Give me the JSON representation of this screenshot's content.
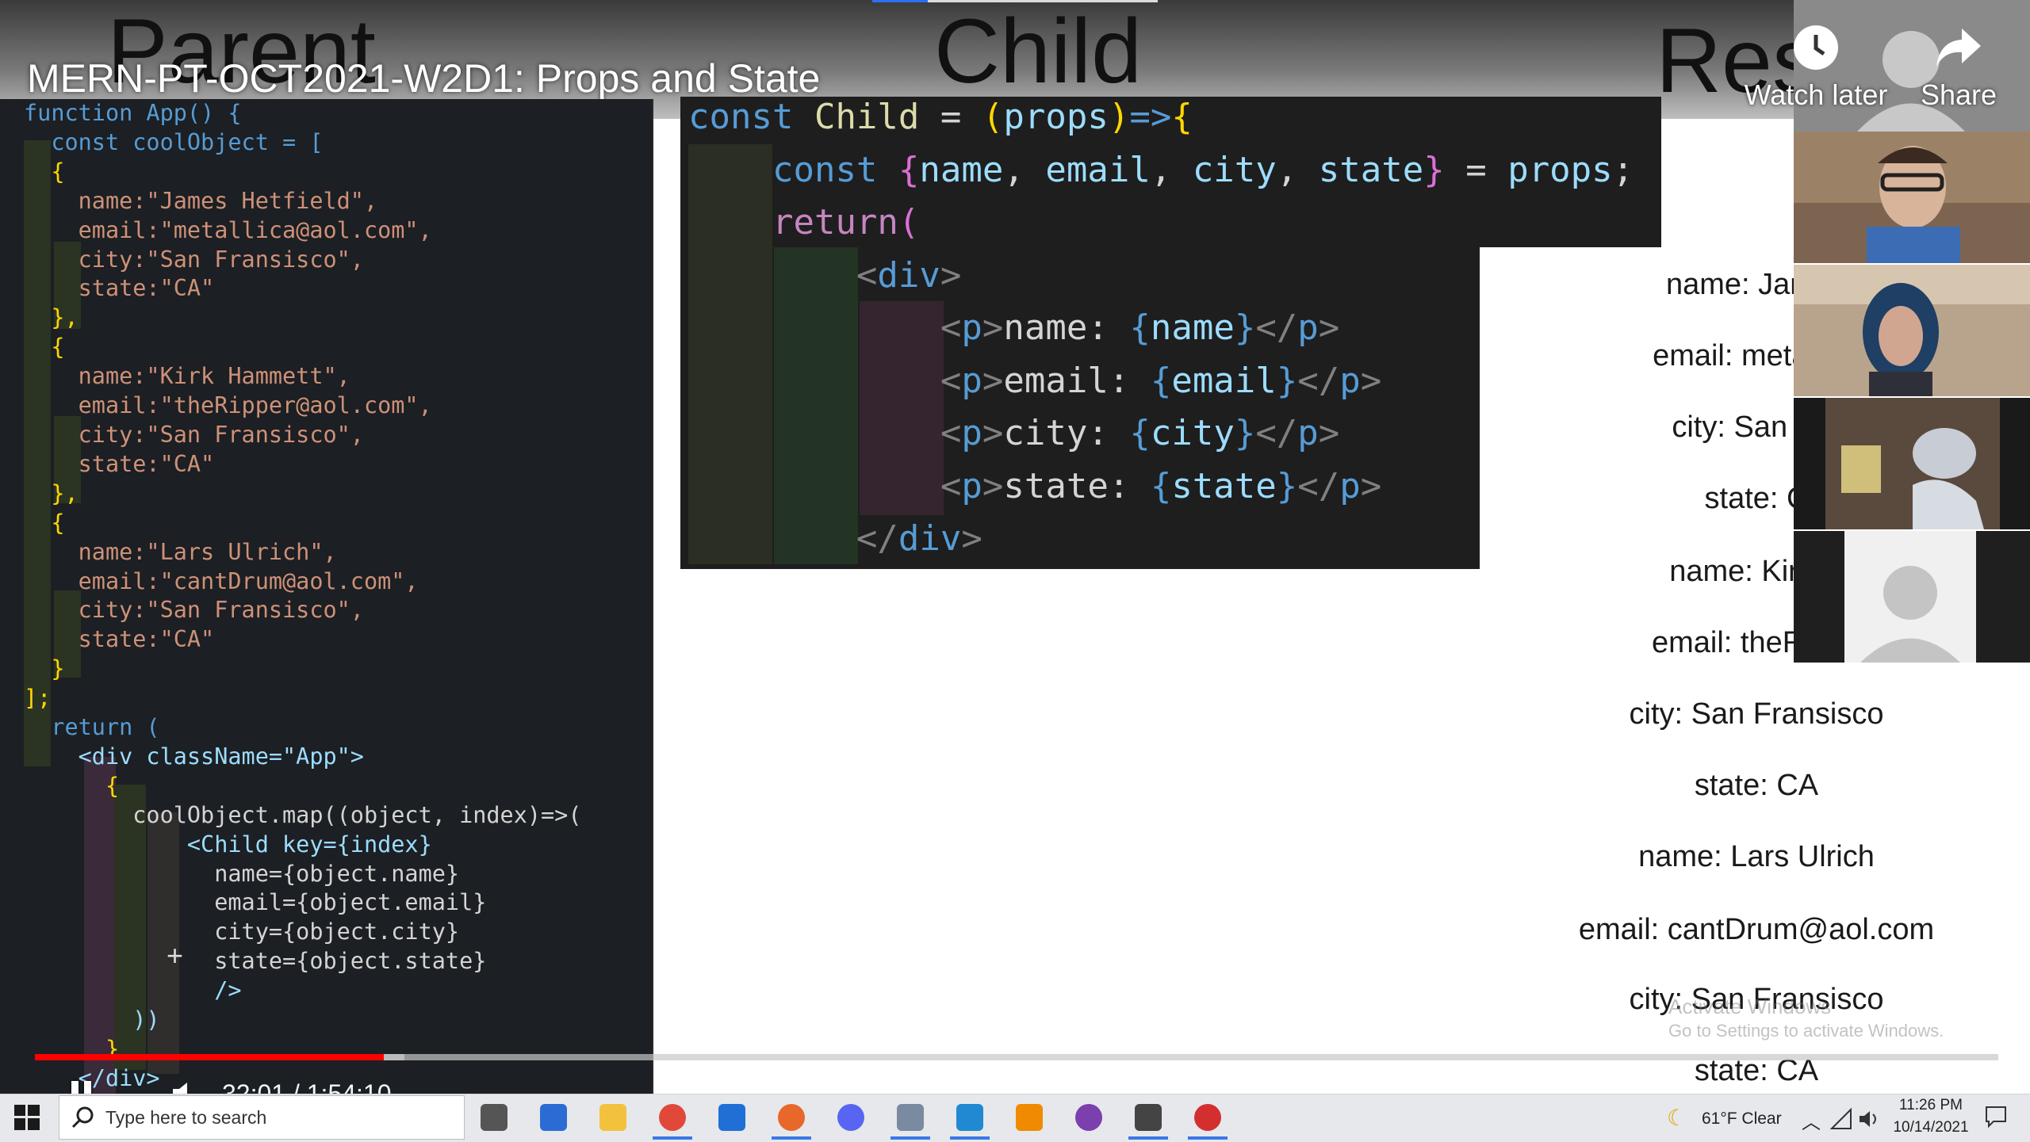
{
  "slide": {
    "heading_parent": "Parent",
    "heading_child": "Child",
    "heading_result": "Res"
  },
  "video": {
    "title": "MERN-PT-OCT2021-W2D1: Props and State",
    "watch_later_label": "Watch later",
    "share_label": "Share",
    "time_display": "32:01 / 1:54:10",
    "progress_fraction": 0.18
  },
  "code_left": {
    "lines": [
      "function App() {",
      "  const coolObject = [",
      "  {",
      "    name:\"James Hetfield\",",
      "    email:\"metallica@aol.com\",",
      "    city:\"San Fransisco\",",
      "    state:\"CA\"",
      "  },",
      "  {",
      "    name:\"Kirk Hammett\",",
      "    email:\"theRipper@aol.com\",",
      "    city:\"San Fransisco\",",
      "    state:\"CA\"",
      "  },",
      "  {",
      "    name:\"Lars Ulrich\",",
      "    email:\"cantDrum@aol.com\",",
      "    city:\"San Fransisco\",",
      "    state:\"CA\"",
      "  }",
      "];",
      "  return (",
      "    <div className=\"App\">",
      "      {",
      "        coolObject.map((object, index)=>(",
      "            <Child key={index}",
      "              name={object.name}",
      "              email={object.email}",
      "              city={object.city}",
      "              state={object.state}",
      "              />",
      "        ))",
      "      }",
      "    </div>"
    ]
  },
  "code_right": {
    "line1": "const Child = (props)=>{",
    "line2": "    const {name, email, city, state} = props;",
    "line3": "    return(",
    "line4": "        <div>",
    "line5": "            <p>name: {name}</p>",
    "line6": "            <p>email: {email}</p>",
    "line7": "            <p>city: {city}</p>",
    "line8": "            <p>state: {state}</p>",
    "line9": "        </div>"
  },
  "result_lines": [
    "name: James",
    "email: metallica",
    "city: San Fra",
    "state: C",
    "name: Kirk H",
    "email: theRippe",
    "city: San Fransisco",
    "state: CA",
    "name: Lars Ulrich",
    "email: cantDrum@aol.com",
    "city: San Fransisco",
    "state: CA"
  ],
  "windows_watermark": {
    "line1": "Activate Windows",
    "line2": "Go to Settings to activate Windows."
  },
  "taskbar": {
    "search_placeholder": "Type here to search",
    "weather": "61°F  Clear",
    "time": "11:26 PM",
    "date": "10/14/2021",
    "apps": [
      "task-view",
      "snip",
      "file-explorer",
      "chrome",
      "mail",
      "firefox",
      "discord",
      "photos",
      "vscode",
      "vlc",
      "tor",
      "settings",
      "zoom"
    ]
  },
  "colors": {
    "progress_red": "#ff0000",
    "editor_bg": "#1e1e1e",
    "taskbar_bg": "#e6e8ec"
  }
}
